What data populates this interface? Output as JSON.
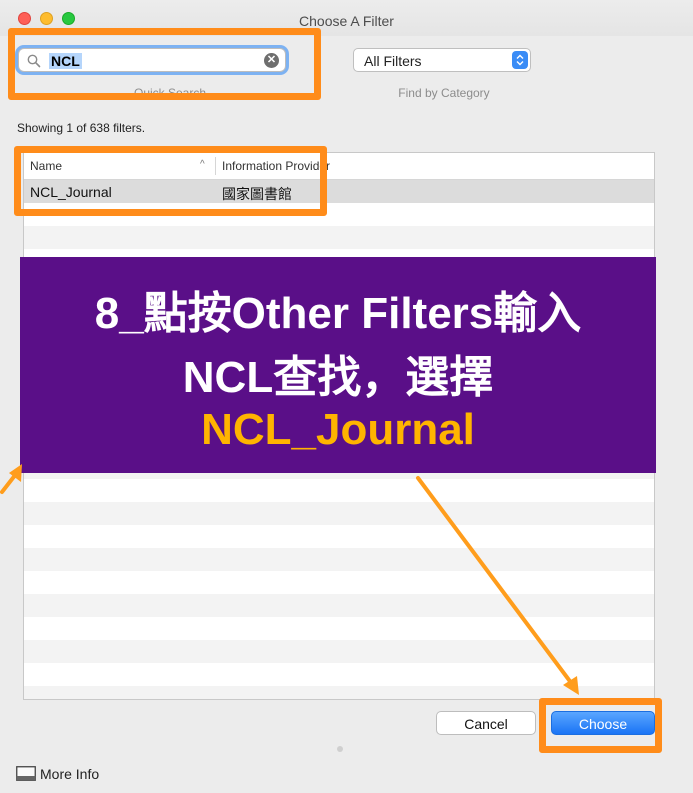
{
  "window": {
    "title": "Choose A Filter"
  },
  "toolbar": {
    "search": {
      "value": "NCL",
      "caption": "Quick Search"
    },
    "category": {
      "selected": "All Filters",
      "caption": "Find by Category"
    }
  },
  "results": {
    "status": "Showing 1 of 638 filters.",
    "columns": [
      "Name",
      "Information Provider"
    ],
    "rows": [
      {
        "name": "NCL_Journal",
        "provider": "國家圖書館"
      }
    ]
  },
  "buttons": {
    "cancel": "Cancel",
    "choose": "Choose"
  },
  "footer": {
    "more_info": "More Info"
  },
  "annotation": {
    "line1": "8_點按Other Filters輸入",
    "line2": "NCL查找，選擇",
    "line3": "NCL_Journal",
    "colors": {
      "banner_bg": "#5a0f88",
      "highlight": "#ff8c1a",
      "accent_text": "#ffb400"
    }
  }
}
